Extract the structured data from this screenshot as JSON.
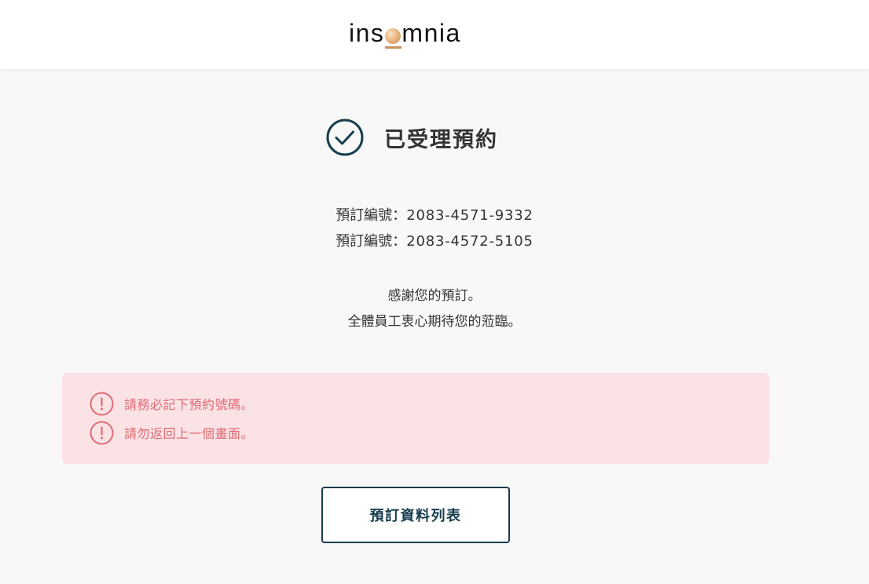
{
  "header": {
    "logo_left": "ins",
    "logo_right": "mnia"
  },
  "confirmation": {
    "title": "已受理預約",
    "bookings": [
      {
        "label": "預訂編號：",
        "number": "2083-4571-9332"
      },
      {
        "label": "預訂編號：",
        "number": "2083-4572-5105"
      }
    ],
    "thanks_lines": [
      "感謝您的預訂。",
      "全體員工衷心期待您的蒞臨。"
    ]
  },
  "alert": {
    "messages": [
      "請務必記下預約號碼。",
      "請勿返回上一個畫面。"
    ],
    "text_color": "#e06b73",
    "background": "#fae2e5"
  },
  "actions": {
    "booking_list_label": "預訂資料列表"
  },
  "colors": {
    "accent": "#173d4d",
    "logo_gold": "#c8925d"
  },
  "icons": {
    "success": "check-circle-icon",
    "warning": "exclamation-circle-icon"
  }
}
